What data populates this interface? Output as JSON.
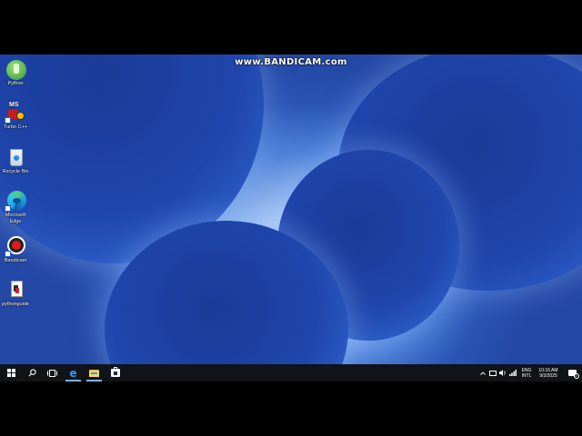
{
  "watermark": "www.BANDICAM.com",
  "desktop_icons": [
    {
      "label": "Python"
    },
    {
      "label": "Turbo C++",
      "badge": "MS"
    },
    {
      "label": "Recycle Bin"
    },
    {
      "label": "Microsoft Edge"
    },
    {
      "label": "Bandicam"
    },
    {
      "label": "pythonguide"
    }
  ],
  "taskbar": {
    "icons": [
      "windows-start-icon",
      "search-icon",
      "task-view-icon",
      "edge-icon",
      "file-explorer-icon",
      "store-icon"
    ],
    "tray": {
      "lang_line1": "ENG",
      "lang_line2": "INTL",
      "time": "10:16 AM",
      "date": "9/3/2025",
      "notification_count": "2"
    }
  }
}
